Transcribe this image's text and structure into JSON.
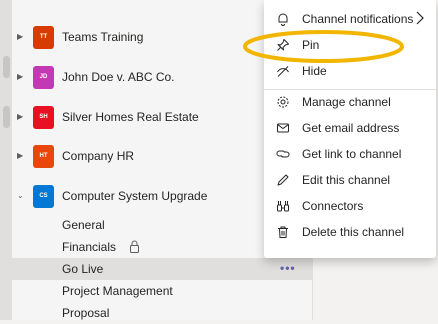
{
  "teams": [
    {
      "initials": "TT",
      "name": "Teams Training",
      "color": "#d83b01"
    },
    {
      "initials": "JD",
      "name": "John Doe v. ABC Co.",
      "color": "#c239b3"
    },
    {
      "initials": "SH",
      "name": "Silver Homes Real Estate",
      "color": "#e81123"
    },
    {
      "initials": "HT",
      "name": "Company HR",
      "color": "#e8460a"
    },
    {
      "initials": "CS",
      "name": "Computer System Upgrade",
      "color": "#0078d4"
    }
  ],
  "channels": [
    {
      "label": "General"
    },
    {
      "label": "Financials",
      "icon": "lock-icon"
    },
    {
      "label": "Go Live",
      "selected": true
    },
    {
      "label": "Project Management"
    },
    {
      "label": "Proposal"
    }
  ],
  "more_options_label": "•••",
  "context_menu": [
    {
      "label": "Channel notifications",
      "icon": "bell-icon",
      "has_submenu": true
    },
    {
      "label": "Pin",
      "icon": "pin-icon"
    },
    {
      "label": "Hide",
      "icon": "hide-icon"
    },
    {
      "label": "Manage channel",
      "icon": "gear-icon"
    },
    {
      "label": "Get email address",
      "icon": "mail-icon"
    },
    {
      "label": "Get link to channel",
      "icon": "link-icon"
    },
    {
      "label": "Edit this channel",
      "icon": "pencil-icon"
    },
    {
      "label": "Connectors",
      "icon": "connectors-icon"
    },
    {
      "label": "Delete this channel",
      "icon": "trash-icon"
    }
  ],
  "colors": {
    "highlight_oval": "#f2b600",
    "accent": "#6264a7"
  }
}
